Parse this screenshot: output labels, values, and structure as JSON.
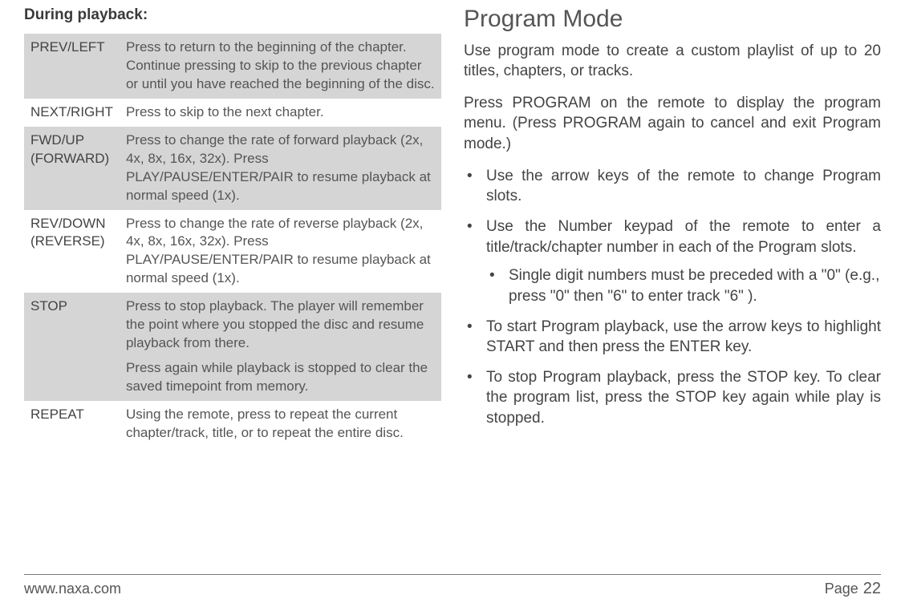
{
  "left": {
    "heading": "During playback:",
    "rows": [
      {
        "key": "PREV/LEFT",
        "desc": [
          "Press to return to the beginning of the chapter. Continue pressing to skip to the previous chapter or until you have reached the beginning of the disc."
        ],
        "shade": true
      },
      {
        "key": "NEXT/RIGHT",
        "desc": [
          "Press to skip to the next chapter."
        ],
        "shade": false
      },
      {
        "key": "FWD/UP (FORWARD)",
        "desc": [
          "Press to change the rate of forward playback (2x, 4x, 8x, 16x, 32x). Press PLAY/PAUSE/ENTER/PAIR to resume playback at normal speed (1x)."
        ],
        "shade": true
      },
      {
        "key": "REV/DOWN (REVERSE)",
        "desc": [
          "Press to change the rate of reverse playback (2x, 4x, 8x, 16x, 32x). Press PLAY/PAUSE/ENTER/PAIR to resume playback at normal speed (1x)."
        ],
        "shade": false
      },
      {
        "key": "STOP",
        "desc": [
          "Press to stop playback. The player will remember the point where you stopped the disc and resume playback from there.",
          "Press again while playback is stopped to clear the saved timepoint from memory."
        ],
        "shade": true
      },
      {
        "key": "REPEAT",
        "desc": [
          "Using the remote, press to repeat the current chapter/track, title, or to repeat the entire disc."
        ],
        "shade": false
      }
    ]
  },
  "right": {
    "heading": "Program Mode",
    "para1": "Use program mode to create a custom playlist of up to 20 titles, chapters, or tracks.",
    "para2": "Press PROGRAM on the remote to display the program menu. (Press PROGRAM again to cancel and exit Program mode.)",
    "bullets": [
      {
        "text": "Use the arrow keys of the remote to change Program slots."
      },
      {
        "text": "Use the Number keypad of the remote to enter a title/track/chapter number in each of the Program slots.",
        "sub": [
          "Single digit numbers must be preceded with a \"0\" (e.g., press \"0\" then \"6\" to enter track \"6\" )."
        ]
      },
      {
        "text": "To start Program playback, use the arrow keys to highlight START and then press the ENTER key."
      },
      {
        "text": "To stop Program playback, press the STOP key. To clear the program list, press the STOP key again while play is stopped."
      }
    ]
  },
  "footer": {
    "url": "www.naxa.com",
    "pageLabel": "Page",
    "pageNumber": "22"
  }
}
